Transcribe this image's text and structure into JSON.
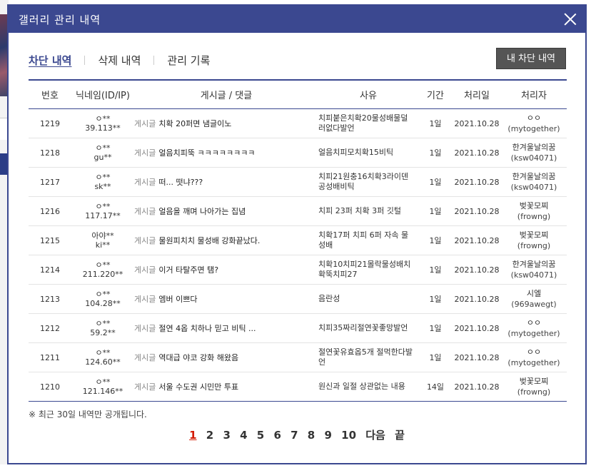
{
  "dialog": {
    "title": "갤러리 관리 내역"
  },
  "tabs": [
    {
      "label": "차단 내역",
      "active": true
    },
    {
      "label": "삭제 내역",
      "active": false
    },
    {
      "label": "관리 기록",
      "active": false
    }
  ],
  "my_block_button": "내 차단 내역",
  "table": {
    "headers": [
      "번호",
      "닉네임(ID/IP)",
      "게시글 / 댓글",
      "사유",
      "기간",
      "처리일",
      "처리자"
    ],
    "rows": [
      {
        "no": "1219",
        "nick": "ㅇ**",
        "ip": "39.113**",
        "kind": "게시글",
        "title": "치확 20퍼면 냄글이노",
        "reason": "치피붙은치확20물성배물덜러없다발언",
        "period": "1일",
        "date": "2021.10.28",
        "processor": "ㅇㅇ",
        "processor_id": "(mytogether)"
      },
      {
        "no": "1218",
        "nick": "ㅇ**",
        "ip": "gu**",
        "kind": "게시글",
        "title": "얼음치피뚝 ㅋㅋㅋㅋㅋㅋㅋㅋ",
        "reason": "얼음치피모치확15비틱",
        "period": "1일",
        "date": "2021.10.28",
        "processor": "한겨울날의꿈",
        "processor_id": "(ksw04071)"
      },
      {
        "no": "1217",
        "nick": "ㅇ**",
        "ip": "sk**",
        "kind": "게시글",
        "title": "떠... 떳냐???",
        "reason": "치피21원충16치확3라이덴공성배비틱",
        "period": "1일",
        "date": "2021.10.28",
        "processor": "한겨울날의꿈",
        "processor_id": "(ksw04071)"
      },
      {
        "no": "1216",
        "nick": "ㅇ**",
        "ip": "117.17**",
        "kind": "게시글",
        "title": "얼음을 깨며 나아가는 집념",
        "reason": "치피 23퍼 치확 3퍼 깃털",
        "period": "1일",
        "date": "2021.10.28",
        "processor": "벚꽃모찌",
        "processor_id": "(frowng)"
      },
      {
        "no": "1215",
        "nick": "아야**",
        "ip": "ki**",
        "kind": "게시글",
        "title": "물원피치치 물성배 강화끝났다.",
        "reason": "치확17퍼 치피 6퍼 자속 물성배",
        "period": "1일",
        "date": "2021.10.28",
        "processor": "벚꽃모찌",
        "processor_id": "(frowng)"
      },
      {
        "no": "1214",
        "nick": "ㅇ**",
        "ip": "211.220**",
        "kind": "게시글",
        "title": "이거 타탈주면 탬?",
        "reason": "치확10치피21몰락물성배치확뚝치피27",
        "period": "1일",
        "date": "2021.10.28",
        "processor": "한겨울날의꿈",
        "processor_id": "(ksw04071)"
      },
      {
        "no": "1213",
        "nick": "ㅇ**",
        "ip": "104.28**",
        "kind": "게시글",
        "title": "엠버 이쁘다",
        "reason": "음란성",
        "period": "1일",
        "date": "2021.10.28",
        "processor": "시엘",
        "processor_id": "(969awegt)"
      },
      {
        "no": "1212",
        "nick": "ㅇ**",
        "ip": "59.2**",
        "kind": "게시글",
        "title": "절연 4옵 치하나 믿고 비틱 ...",
        "reason": "치피35짜리절연꽃좋망발언",
        "period": "1일",
        "date": "2021.10.28",
        "processor": "ㅇㅇ",
        "processor_id": "(mytogether)"
      },
      {
        "no": "1211",
        "nick": "ㅇ**",
        "ip": "124.60**",
        "kind": "게시글",
        "title": "역대급 야코 강화 해왔음",
        "reason": "절연꽃유효옵5개 절먹한다발언",
        "period": "1일",
        "date": "2021.10.28",
        "processor": "ㅇㅇ",
        "processor_id": "(mytogether)"
      },
      {
        "no": "1210",
        "nick": "ㅇ**",
        "ip": "121.146**",
        "kind": "게시글",
        "title": "서울 수도권 시민만 투표",
        "reason": "원신과 일절 상관없는 내용",
        "period": "14일",
        "date": "2021.10.28",
        "processor": "벚꽃모찌",
        "processor_id": "(frowng)"
      }
    ]
  },
  "note": "※ 최근 30일 내역만 공개됩니다.",
  "pagination": {
    "pages": [
      "1",
      "2",
      "3",
      "4",
      "5",
      "6",
      "7",
      "8",
      "9",
      "10"
    ],
    "current": "1",
    "next": "다음",
    "last": "끝"
  },
  "colors": {
    "accent": "#3b4890",
    "current_page": "#d31900"
  }
}
